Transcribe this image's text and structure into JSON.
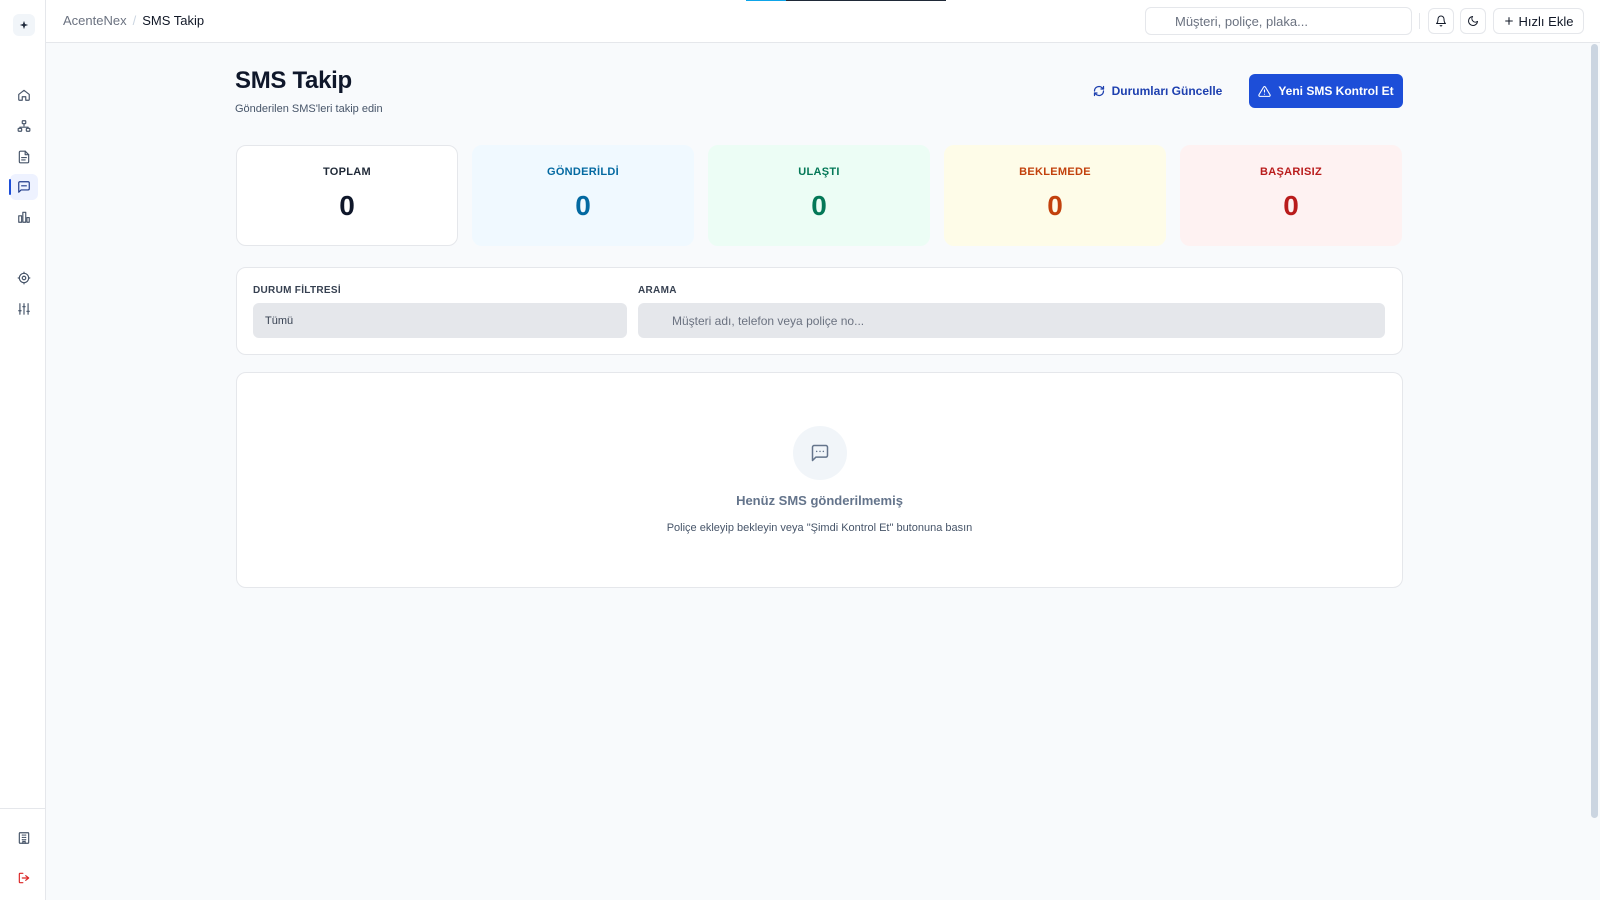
{
  "breadcrumb": {
    "root": "AcenteNex",
    "separator": "/",
    "current": "SMS Takip"
  },
  "topbar": {
    "search_placeholder": "Müşteri, poliçe, plaka...",
    "quick_add_label": "Hızlı Ekle",
    "loading_progress_percent": 20
  },
  "sidebar": {
    "items": [
      {
        "id": "home",
        "icon": "home-icon",
        "active": false
      },
      {
        "id": "customers",
        "icon": "org-chart-icon",
        "active": false
      },
      {
        "id": "policies",
        "icon": "document-icon",
        "active": false
      },
      {
        "id": "sms",
        "icon": "message-icon",
        "active": true
      },
      {
        "id": "reports",
        "icon": "bar-chart-icon",
        "active": false
      },
      {
        "id": "settings",
        "icon": "gear-icon",
        "active": false
      },
      {
        "id": "preferences",
        "icon": "sliders-icon",
        "active": false
      }
    ],
    "bottom": [
      {
        "id": "company",
        "icon": "building-icon"
      },
      {
        "id": "logout",
        "icon": "logout-icon"
      }
    ]
  },
  "page": {
    "title": "SMS Takip",
    "subtitle": "Gönderilen SMS'leri takip edin",
    "refresh_button": "Durumları Güncelle",
    "primary_button": "Yeni SMS Kontrol Et"
  },
  "stats": [
    {
      "id": "total",
      "label": "TOPLAM",
      "value": "0",
      "label_color": "#1f2937",
      "value_color": "#0f172a",
      "bg": "#ffffff",
      "border": "#e5e7eb"
    },
    {
      "id": "sent",
      "label": "GÖNDERİLDİ",
      "value": "0",
      "label_color": "#0369a1",
      "value_color": "#0369a1",
      "bg": "#f0f9ff",
      "border": "#f0f9ff"
    },
    {
      "id": "delivered",
      "label": "ULAŞTI",
      "value": "0",
      "label_color": "#047857",
      "value_color": "#047857",
      "bg": "#ecfdf5",
      "border": "#ecfdf5"
    },
    {
      "id": "pending",
      "label": "BEKLEMEDE",
      "value": "0",
      "label_color": "#c2410c",
      "value_color": "#c2410c",
      "bg": "#fefce8",
      "border": "#fefce8"
    },
    {
      "id": "failed",
      "label": "BAŞARISIZ",
      "value": "0",
      "label_color": "#b91c1c",
      "value_color": "#b91c1c",
      "bg": "#fef2f2",
      "border": "#fef2f2"
    }
  ],
  "filters": {
    "status_label": "DURUM FİLTRESİ",
    "status_value": "Tümü",
    "search_label": "ARAMA",
    "search_placeholder": "Müşteri adı, telefon veya poliçe no..."
  },
  "empty_state": {
    "icon": "message-icon",
    "title": "Henüz SMS gönderilmemiş",
    "subtitle": "Poliçe ekleyip bekleyin veya \"Şimdi Kontrol Et\" butonuna basın"
  },
  "colors": {
    "accent": "#1d4ed8",
    "logout": "#dc2626"
  }
}
